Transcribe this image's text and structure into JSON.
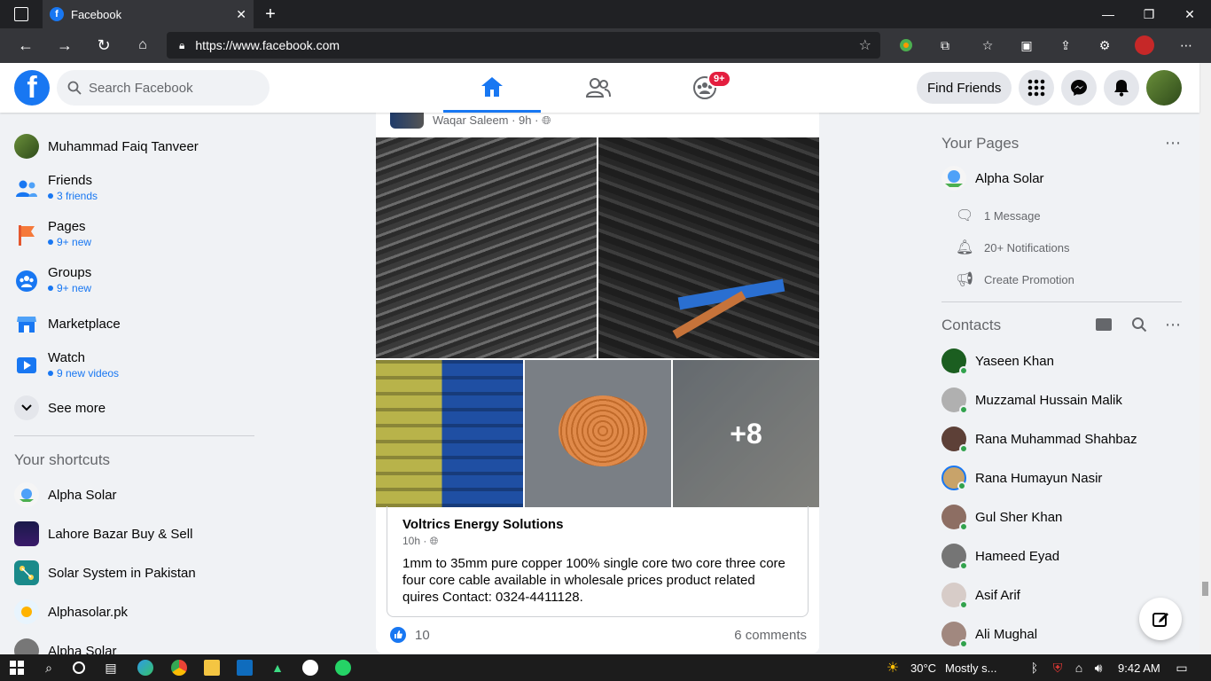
{
  "browser": {
    "tab_title": "Facebook",
    "url": "https://www.facebook.com"
  },
  "header": {
    "search_placeholder": "Search Facebook",
    "notif_badge": "9+",
    "find_friends": "Find Friends"
  },
  "left": {
    "items": [
      {
        "label": "Muhammad Faiq Tanveer",
        "sub": ""
      },
      {
        "label": "Friends",
        "sub": "3 friends"
      },
      {
        "label": "Pages",
        "sub": "9+ new"
      },
      {
        "label": "Groups",
        "sub": "9+ new"
      },
      {
        "label": "Marketplace",
        "sub": ""
      },
      {
        "label": "Watch",
        "sub": "9 new videos"
      },
      {
        "label": "See more",
        "sub": ""
      }
    ],
    "shortcuts_title": "Your shortcuts",
    "shortcuts": [
      "Alpha Solar",
      "Lahore Bazar Buy & Sell",
      "Solar System in Pakistan",
      "Alphasolar.pk",
      "Alpha Solar"
    ]
  },
  "post": {
    "author_line": "Waqar Saleem · 9h ·",
    "more_photos": "+8",
    "shared_name": "Voltrics Energy Solutions",
    "shared_time": "10h ·",
    "shared_text": "1mm to 35mm pure copper 100% single core two core three core four core cable available in wholesale prices product related quires Contact: 0324-4411128.",
    "likes": "10",
    "comments": "6 comments"
  },
  "right": {
    "pages_title": "Your Pages",
    "page_name": "Alpha Solar",
    "page_items": [
      "1 Message",
      "20+ Notifications",
      "Create Promotion"
    ],
    "contacts_title": "Contacts",
    "contacts": [
      "Yaseen Khan",
      "Muzzamal Hussain Malik",
      "Rana Muhammad Shahbaz",
      "Rana Humayun Nasir",
      "Gul Sher Khan",
      "Hameed Eyad",
      "Asif Arif",
      "Ali Mughal"
    ]
  },
  "taskbar": {
    "temp": "30°C",
    "weather": "Mostly s...",
    "time": "9:42 AM"
  },
  "colors": {
    "fb_blue": "#1877f2",
    "badge_red": "#e41e3f",
    "online_green": "#31a24c"
  }
}
